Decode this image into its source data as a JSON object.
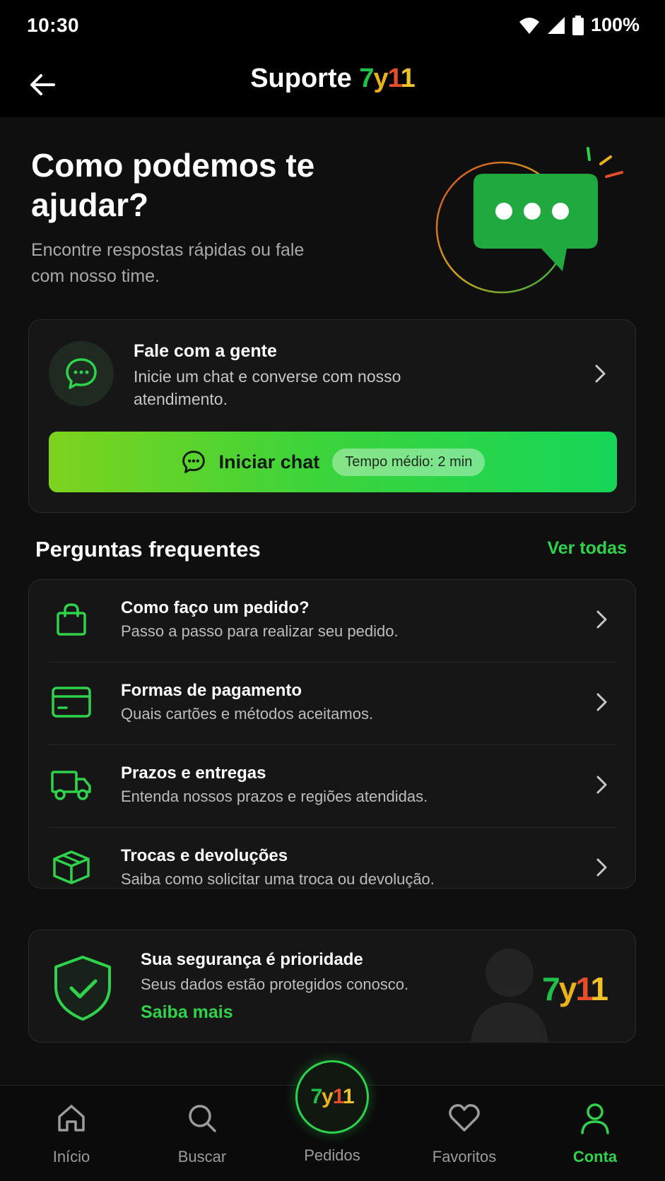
{
  "status_bar": {
    "time": "10:30",
    "battery": "100%"
  },
  "app_bar": {
    "title": "Suporte",
    "brand_parts": [
      "7",
      "y",
      "1",
      "1"
    ]
  },
  "hero": {
    "title": "Como podemos te ajudar?",
    "subtitle": "Encontre respostas rápidas ou fale com nosso time."
  },
  "chat_card": {
    "title": "Fale com a gente",
    "description": "Inicie um chat e converse com nosso atendimento.",
    "button_label": "Iniciar chat",
    "wait_time": "Tempo médio: 2 min"
  },
  "faq": {
    "heading": "Perguntas frequentes",
    "see_all": "Ver todas",
    "items": [
      {
        "icon": "shopping-bag-icon",
        "title": "Como faço um pedido?",
        "description": "Passo a passo para realizar seu pedido."
      },
      {
        "icon": "credit-card-icon",
        "title": "Formas de pagamento",
        "description": "Quais cartões e métodos aceitamos."
      },
      {
        "icon": "truck-icon",
        "title": "Prazos e entregas",
        "description": "Entenda nossos prazos e regiões atendidas."
      },
      {
        "icon": "box-icon",
        "title": "Trocas e devoluções",
        "description": "Saiba como solicitar uma troca ou devolução."
      }
    ]
  },
  "security": {
    "title": "Sua segurança é prioridade",
    "description": "Seus dados estão protegidos conosco.",
    "link": "Saiba mais"
  },
  "bottom_nav": {
    "items": [
      {
        "label": "Início",
        "icon": "home-icon"
      },
      {
        "label": "Buscar",
        "icon": "search-icon"
      },
      {
        "label": "Pedidos",
        "icon": "brand-logo"
      },
      {
        "label": "Favoritos",
        "icon": "heart-icon"
      },
      {
        "label": "Conta",
        "icon": "user-icon"
      }
    ],
    "active": "Conta"
  },
  "colors": {
    "accent": "#2fd24b",
    "background": "#0f0f0f",
    "card": "#161616"
  }
}
